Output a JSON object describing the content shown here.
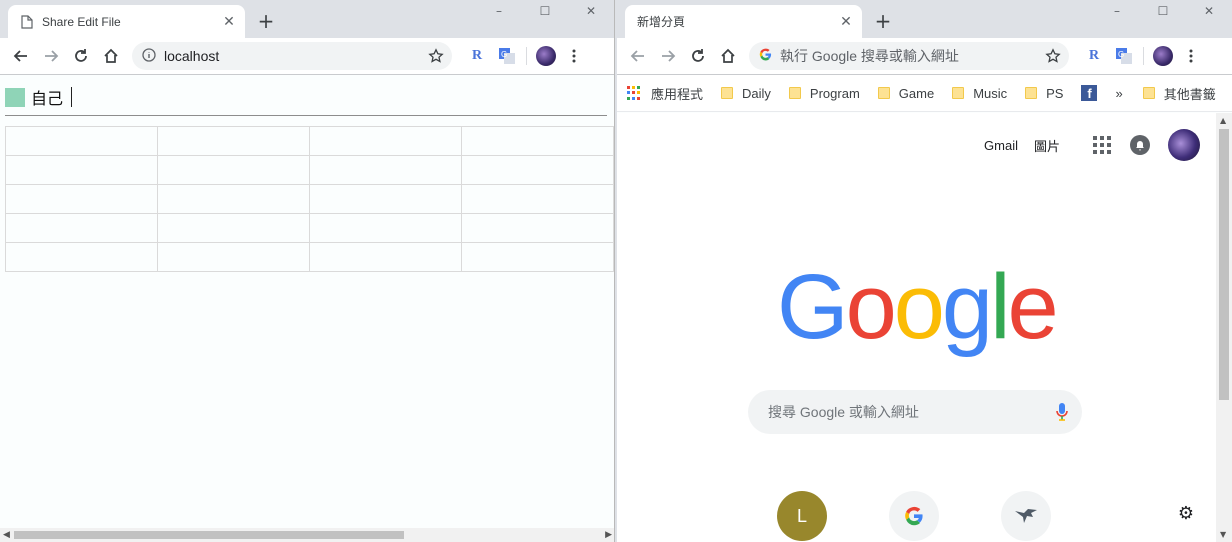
{
  "left": {
    "tab_title": "Share Edit File",
    "url": "localhost",
    "user_name": "自己",
    "user_color": "#8fd4b7",
    "grid": {
      "rows": 5,
      "cols": 4
    }
  },
  "right": {
    "tab_title": "新增分頁",
    "omnibox_placeholder": "執行 Google 搜尋或輸入網址",
    "bookmarks": [
      {
        "label": "應用程式",
        "icon": "apps-grid-icon"
      },
      {
        "label": "Daily",
        "icon": "folder-icon"
      },
      {
        "label": "Program",
        "icon": "folder-icon"
      },
      {
        "label": "Game",
        "icon": "folder-icon"
      },
      {
        "label": "Music",
        "icon": "folder-icon"
      },
      {
        "label": "PS",
        "icon": "folder-icon"
      }
    ],
    "overflow_label": "»",
    "other_bookmarks": "其他書籤",
    "top_links": {
      "gmail": "Gmail",
      "images": "圖片"
    },
    "logo": "Google",
    "search_placeholder": "搜尋 Google 或輸入網址",
    "tiles": [
      {
        "letter": "L",
        "color": "#98872c"
      },
      {
        "letter": "",
        "icon": "google-g-icon"
      },
      {
        "letter": "",
        "icon": "bird-icon"
      }
    ]
  },
  "window_controls": {
    "minimize": "–",
    "maximize": "☐",
    "close": "✕"
  }
}
